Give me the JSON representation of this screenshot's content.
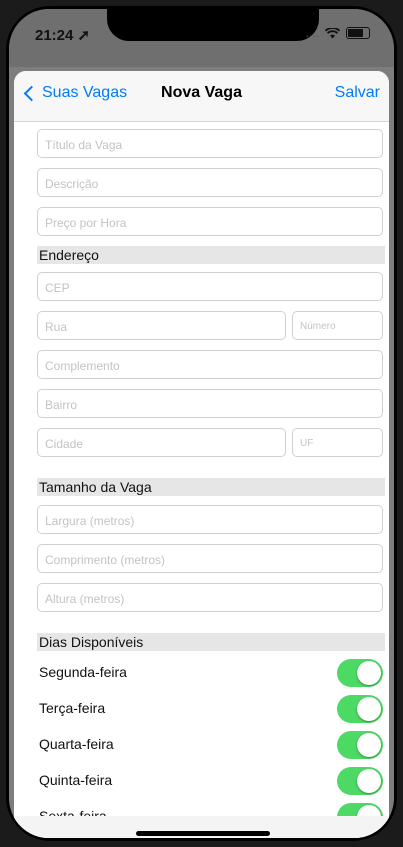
{
  "status": {
    "time": "21:24",
    "signal_text": "...."
  },
  "nav": {
    "back_label": "Suas Vagas",
    "title": "Nova Vaga",
    "save_label": "Salvar"
  },
  "fields": {
    "titulo": "Título da Vaga",
    "descricao": "Descrição",
    "preco": "Preço por Hora",
    "cep": "CEP",
    "rua": "Rua",
    "numero": "Número",
    "complemento": "Complemento",
    "bairro": "Bairro",
    "cidade": "Cidade",
    "uf": "UF",
    "largura": "Largura (metros)",
    "comprimento": "Comprimento (metros)",
    "altura": "Altura (metros)"
  },
  "sections": {
    "endereco": "Endereço",
    "tamanho": "Tamanho da Vaga",
    "dias": "Dias Disponíveis"
  },
  "days": [
    {
      "label": "Segunda-feira",
      "enabled": true
    },
    {
      "label": "Terça-feira",
      "enabled": true
    },
    {
      "label": "Quarta-feira",
      "enabled": true
    },
    {
      "label": "Quinta-feira",
      "enabled": true
    },
    {
      "label": "Sexta-feira",
      "enabled": true
    }
  ],
  "colors": {
    "accent": "#007aff",
    "toggle_on": "#4cd964"
  }
}
